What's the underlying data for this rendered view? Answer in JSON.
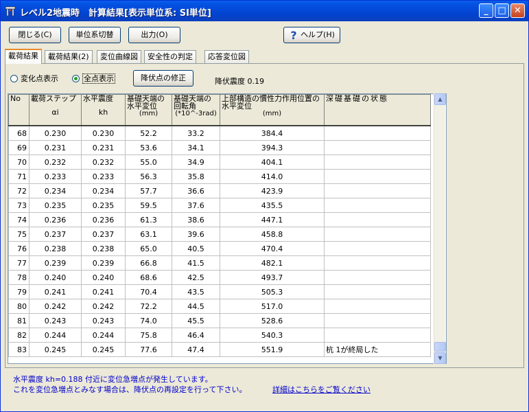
{
  "window": {
    "title": "レベル2地震時　計算結果[表示単位系: SI単位]",
    "controls": {
      "minimize": "_",
      "maximize": "□",
      "close": "✕"
    }
  },
  "toolbar": {
    "close_label": "閉じる(C)",
    "units_label": "単位系切替",
    "output_label": "出力(O)",
    "help_label": "ヘルプ(H)"
  },
  "tabs": [
    "載荷結果",
    "載荷結果(2)",
    "変位曲線図",
    "安全性の判定",
    "応答変位図"
  ],
  "options": {
    "radio_change_points": "変化点表示",
    "radio_all_points": "全点表示",
    "selected": "全点表示",
    "yield_fix_label": "降伏点の修正",
    "yield_seismic_text": "降伏震度 0.19"
  },
  "table": {
    "headers": {
      "no": "No",
      "step": "載荷ステップ",
      "step_sub": "αi",
      "kh": "水平震度",
      "kh_sub": "kh",
      "disp": "基礎天端の水平変位",
      "disp_unit": "(mm)",
      "rot": "基礎天端の回転角",
      "rot_unit": "(*10^-3rad)",
      "upper": "上部構造の慣性力作用位置の水平変位",
      "upper_unit": "(mm)",
      "state": "深礎基礎の状態"
    },
    "rows": [
      {
        "no": "68",
        "a": "0.230",
        "kh": "0.230",
        "d": "52.2",
        "r": "33.2",
        "u": "384.4",
        "s": ""
      },
      {
        "no": "69",
        "a": "0.231",
        "kh": "0.231",
        "d": "53.6",
        "r": "34.1",
        "u": "394.3",
        "s": ""
      },
      {
        "no": "70",
        "a": "0.232",
        "kh": "0.232",
        "d": "55.0",
        "r": "34.9",
        "u": "404.1",
        "s": ""
      },
      {
        "no": "71",
        "a": "0.233",
        "kh": "0.233",
        "d": "56.3",
        "r": "35.8",
        "u": "414.0",
        "s": ""
      },
      {
        "no": "72",
        "a": "0.234",
        "kh": "0.234",
        "d": "57.7",
        "r": "36.6",
        "u": "423.9",
        "s": ""
      },
      {
        "no": "73",
        "a": "0.235",
        "kh": "0.235",
        "d": "59.5",
        "r": "37.6",
        "u": "435.5",
        "s": ""
      },
      {
        "no": "74",
        "a": "0.236",
        "kh": "0.236",
        "d": "61.3",
        "r": "38.6",
        "u": "447.1",
        "s": ""
      },
      {
        "no": "75",
        "a": "0.237",
        "kh": "0.237",
        "d": "63.1",
        "r": "39.6",
        "u": "458.8",
        "s": ""
      },
      {
        "no": "76",
        "a": "0.238",
        "kh": "0.238",
        "d": "65.0",
        "r": "40.5",
        "u": "470.4",
        "s": ""
      },
      {
        "no": "77",
        "a": "0.239",
        "kh": "0.239",
        "d": "66.8",
        "r": "41.5",
        "u": "482.1",
        "s": ""
      },
      {
        "no": "78",
        "a": "0.240",
        "kh": "0.240",
        "d": "68.6",
        "r": "42.5",
        "u": "493.7",
        "s": ""
      },
      {
        "no": "79",
        "a": "0.241",
        "kh": "0.241",
        "d": "70.4",
        "r": "43.5",
        "u": "505.3",
        "s": ""
      },
      {
        "no": "80",
        "a": "0.242",
        "kh": "0.242",
        "d": "72.2",
        "r": "44.5",
        "u": "517.0",
        "s": ""
      },
      {
        "no": "81",
        "a": "0.243",
        "kh": "0.243",
        "d": "74.0",
        "r": "45.5",
        "u": "528.6",
        "s": ""
      },
      {
        "no": "82",
        "a": "0.244",
        "kh": "0.244",
        "d": "75.8",
        "r": "46.4",
        "u": "540.3",
        "s": ""
      },
      {
        "no": "83",
        "a": "0.245",
        "kh": "0.245",
        "d": "77.6",
        "r": "47.4",
        "u": "551.9",
        "s": "杭 1が終局した"
      }
    ]
  },
  "status": {
    "line1": "水平震度 kh=0.188 付近に変位急増点が発生しています。",
    "line2": "これを変位急増点とみなす場合は、降伏点の再設定を行って下さい。",
    "link": "詳細はこちらをご覧ください"
  }
}
